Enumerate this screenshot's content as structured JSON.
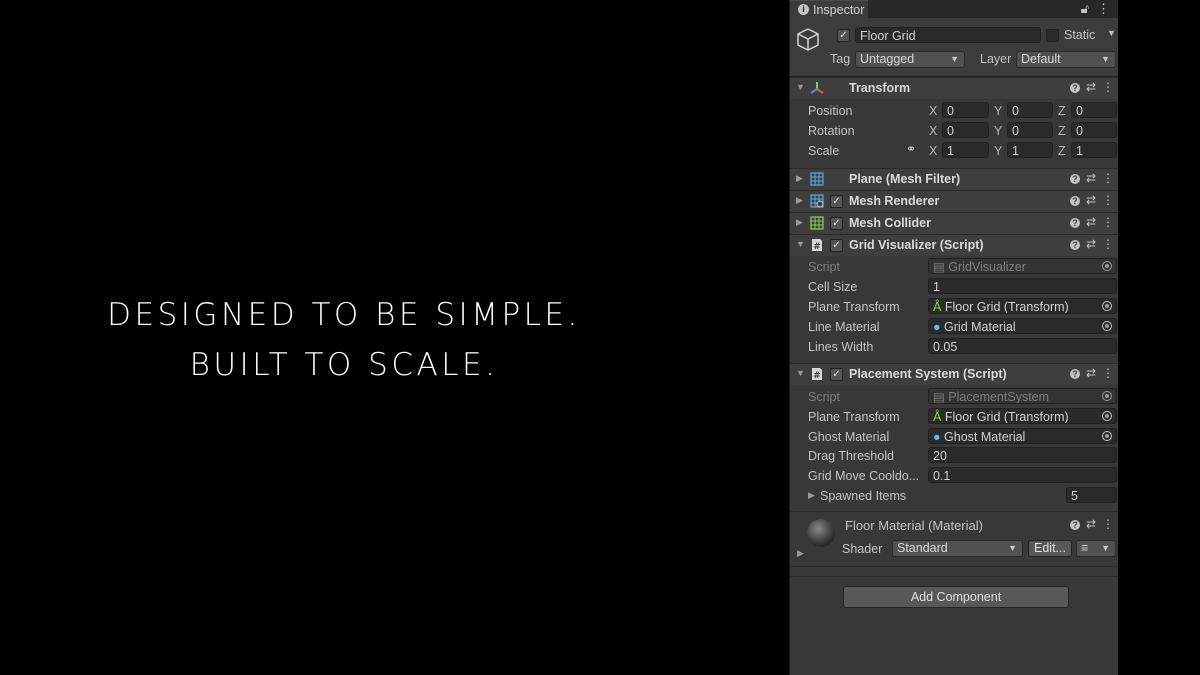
{
  "tagline": {
    "line1": "DESIGNED TO BE SIMPLE.",
    "line2": "BUILT TO SCALE."
  },
  "inspector": {
    "tab_label": "Inspector",
    "object": {
      "name": "Floor Grid",
      "active": true,
      "static_label": "Static",
      "tag_label": "Tag",
      "tag_value": "Untagged",
      "layer_label": "Layer",
      "layer_value": "Default"
    },
    "transform": {
      "title": "Transform",
      "rows": [
        {
          "label": "Position",
          "x": "0",
          "y": "0",
          "z": "0"
        },
        {
          "label": "Rotation",
          "x": "0",
          "y": "0",
          "z": "0"
        },
        {
          "label": "Scale",
          "x": "1",
          "y": "1",
          "z": "1"
        }
      ],
      "axes": {
        "x": "X",
        "y": "Y",
        "z": "Z"
      }
    },
    "components": {
      "mesh_filter": "Plane (Mesh Filter)",
      "mesh_renderer": "Mesh Renderer",
      "mesh_collider": "Mesh Collider"
    },
    "grid_visualizer": {
      "title": "Grid Visualizer (Script)",
      "script_label": "Script",
      "script_value": "GridVisualizer",
      "cell_size_label": "Cell Size",
      "cell_size_value": "1",
      "plane_transform_label": "Plane Transform",
      "plane_transform_value": "Floor Grid (Transform)",
      "line_material_label": "Line Material",
      "line_material_value": "Grid Material",
      "lines_width_label": "Lines Width",
      "lines_width_value": "0.05"
    },
    "placement_system": {
      "title": "Placement System (Script)",
      "script_label": "Script",
      "script_value": "PlacementSystem",
      "plane_transform_label": "Plane Transform",
      "plane_transform_value": "Floor Grid (Transform)",
      "ghost_material_label": "Ghost Material",
      "ghost_material_value": "Ghost Material",
      "drag_threshold_label": "Drag Threshold",
      "drag_threshold_value": "20",
      "grid_move_label": "Grid Move Cooldo...",
      "grid_move_value": "0.1",
      "spawned_items_label": "Spawned Items",
      "spawned_items_value": "5"
    },
    "material": {
      "title": "Floor Material (Material)",
      "shader_label": "Shader",
      "shader_value": "Standard",
      "edit_label": "Edit..."
    },
    "add_component_label": "Add Component"
  }
}
